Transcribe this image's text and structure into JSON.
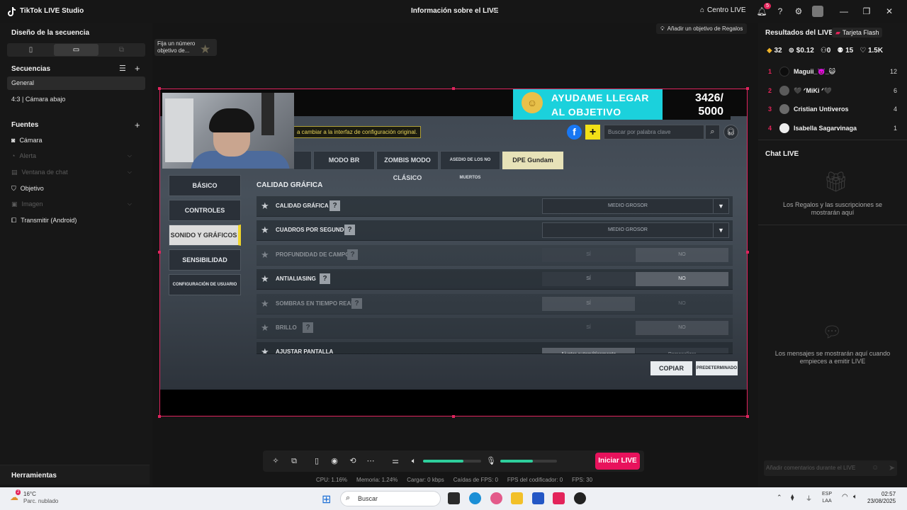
{
  "titlebar": {
    "app_title": "TikTok LIVE Studio",
    "live_info": "Información sobre el LIVE",
    "center_live": "Centro LIVE",
    "notif_count": "5"
  },
  "left": {
    "design_title": "Diseño de la secuencia",
    "sequences_title": "Secuencias",
    "sequences": [
      "General",
      "4:3 | Cámara abajo"
    ],
    "sources_title": "Fuentes",
    "sources": [
      {
        "label": "Cámara",
        "icon": "camera-icon",
        "dim": false
      },
      {
        "label": "Alerta",
        "icon": "alert-icon",
        "dim": true
      },
      {
        "label": "Ventana de chat",
        "icon": "chat-window-icon",
        "dim": true
      },
      {
        "label": "Objetivo",
        "icon": "shield-icon",
        "dim": false
      },
      {
        "label": "Imagen",
        "icon": "image-icon",
        "dim": true
      },
      {
        "label": "Transmitir (Android)",
        "icon": "cast-icon",
        "dim": false
      }
    ],
    "tools_title": "Herramientas"
  },
  "tooltip": {
    "text": "Fija un número objetivo de..."
  },
  "gift_goal": {
    "label": "Añadir un objetivo de Regalos"
  },
  "overlay_goal": {
    "text": "AYUDAME LLEGAR AL OBJETIVO",
    "current": "3426/",
    "target": "5000"
  },
  "game": {
    "note": "a cambiar a la interfaz de configuración original.",
    "search_placeholder": "Buscar por palabra clave",
    "mode_tabs": [
      "MODO BR",
      "ZOMBIS MODO CLÁSICO",
      "ASEDIO DE LOS NO MUERTOS",
      "DPE Gundam"
    ],
    "side_buttons": [
      "BÁSICO",
      "CONTROLES",
      "SONIDO Y GRÁFICOS",
      "SENSIBILIDAD",
      "CONFIGURACIÓN DE USUARIO"
    ],
    "section_title": "CALIDAD GRÁFICA",
    "rows": [
      {
        "label": "CALIDAD GRÁFICA",
        "value": "MEDIO GROSOR"
      },
      {
        "label": "CUADROS POR SEGUNDO",
        "value": "MEDIO GROSOR"
      },
      {
        "label": "PROFUNDIDAD DE CAMPO",
        "yes": "SÍ",
        "no": "NO"
      },
      {
        "label": "ANTIALIASING",
        "yes": "SÍ",
        "no": "NO"
      },
      {
        "label": "SOMBRAS EN TIEMPO REAL",
        "yes": "SÍ",
        "no": "NO"
      },
      {
        "label": "BRILLO",
        "yes": "SÍ",
        "no": "NO"
      },
      {
        "label": "AJUSTAR PANTALLA",
        "yes": "Ajustar automáticamente",
        "no": "Personalizar"
      }
    ],
    "copy": "COPIAR",
    "default": "PREDETERMINADO"
  },
  "right": {
    "results_title": "Resultados del LIVE",
    "flash": "Tarjeta Flash",
    "stats": [
      "32",
      "$0.12",
      "0",
      "15",
      "1.5K"
    ],
    "ranking": [
      {
        "rank": "1",
        "name": "Maguii_👿_😺",
        "score": "12",
        "color": "#0d0d0d"
      },
      {
        "rank": "2",
        "name": "🖤 ᐟMiKi ᐟ🖤",
        "score": "6",
        "color": "#5a5a5a"
      },
      {
        "rank": "3",
        "name": "Cristian Untiveros",
        "score": "4",
        "color": "#6b6b6b"
      },
      {
        "rank": "4",
        "name": "Isabella Sagarvinaga",
        "score": "1",
        "color": "#eeeeee"
      }
    ],
    "chat_title": "Chat LIVE",
    "gifts_empty": "Los Regalos y las suscripciones se mostrarán aquí",
    "messages_empty": "Los mensajes se mostrarán aquí cuando empieces a emitir LIVE",
    "comment_placeholder": "Añadir comentarios durante el LIVE"
  },
  "bottom": {
    "start_live": "Iniciar LIVE",
    "volume_level": 0.7,
    "mic_level": 0.58,
    "stats": [
      "CPU: 1.16%",
      "Memoria: 1.24%",
      "Cargar: 0 kbps",
      "Caídas de FPS: 0",
      "FPS del codificador: 0",
      "FPS: 30"
    ]
  },
  "taskbar": {
    "weather_temp": "16°C",
    "weather_desc": "Parc. nublado",
    "weather_badge": "2",
    "search": "Buscar",
    "lang": "ESP",
    "region": "LAA",
    "time": "02:57",
    "date": "23/08/2025"
  }
}
